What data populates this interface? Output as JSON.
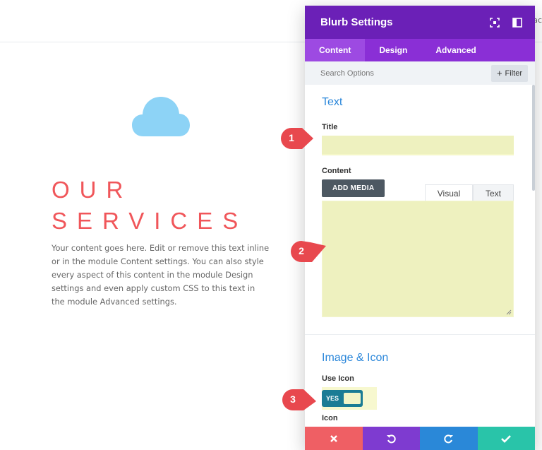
{
  "topbar": {
    "clipped_text": "ac"
  },
  "preview": {
    "heading_line1": "OUR",
    "heading_line2": "SERVICES",
    "body": "Your content goes here. Edit or remove this text inline or in the module Content settings. You can also style every aspect of this content in the module Design settings and even apply custom CSS to this text in the module Advanced settings.",
    "cloud_icon": "cloud-icon",
    "heading_color": "#f0565a",
    "cloud_color": "#8dd3f6"
  },
  "panel": {
    "title": "Blurb Settings",
    "header_icons": [
      "fullscreen-icon",
      "sidebar-toggle-icon"
    ],
    "tabs": [
      {
        "label": "Content",
        "active": true
      },
      {
        "label": "Design",
        "active": false
      },
      {
        "label": "Advanced",
        "active": false
      }
    ],
    "search": {
      "placeholder": "Search Options",
      "filter_label": "Filter"
    },
    "text_section": {
      "title": "Text",
      "title_field_label": "Title",
      "title_value": "",
      "content_field_label": "Content",
      "add_media_label": "ADD MEDIA",
      "editor_tabs": [
        "Visual",
        "Text"
      ],
      "content_value": ""
    },
    "image_section": {
      "title": "Image & Icon",
      "use_icon_label": "Use Icon",
      "use_icon_value": "YES",
      "next_label_peek": "Icon"
    },
    "footer": [
      "discard-icon",
      "undo-icon",
      "redo-icon",
      "save-icon"
    ],
    "colors": {
      "header": "#6b20b7",
      "tabs": "#8a2fd6",
      "accent_blue": "#2b87da",
      "highlight": "#eef1bf",
      "discard": "#ef5f64",
      "undo": "#7e3bd0",
      "redo": "#2a88d8",
      "save": "#29c4a9"
    }
  },
  "callouts": [
    "1",
    "2",
    "3"
  ]
}
